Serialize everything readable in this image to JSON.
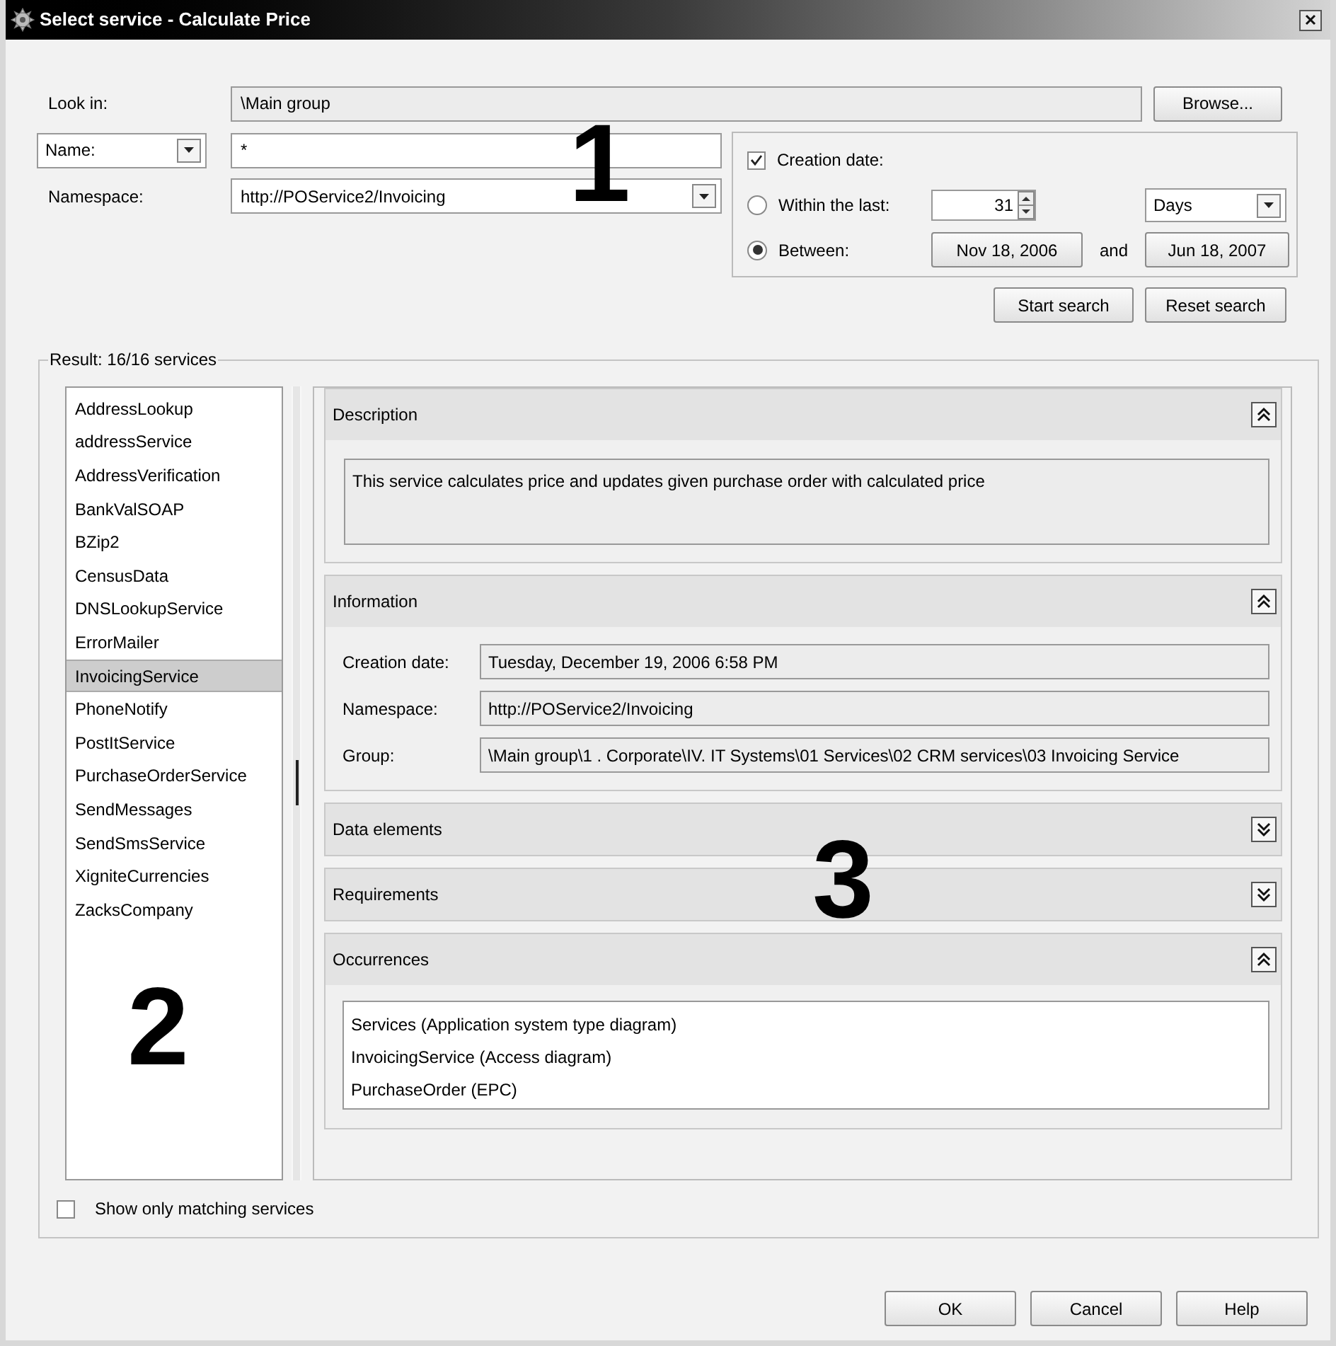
{
  "window": {
    "title": "Select service - Calculate Price"
  },
  "look_in": {
    "label": "Look in:",
    "value": "\\Main group",
    "browse_button": "Browse..."
  },
  "name_filter": {
    "field": "Name:",
    "value": "*"
  },
  "namespace": {
    "label": "Namespace:",
    "value": "http://POService2/Invoicing"
  },
  "creation_date": {
    "label": "Creation date:",
    "checked": true,
    "within_last": {
      "label": "Within the last:",
      "selected": false,
      "value": "31",
      "unit": "Days"
    },
    "between": {
      "label": "Between:",
      "selected": true,
      "from": "Nov 18, 2006",
      "joiner": "and",
      "to": "Jun 18, 2007"
    }
  },
  "search_buttons": [
    "Start search",
    "Reset search"
  ],
  "result": {
    "legend": "Result: 16/16 services",
    "services": [
      {
        "label": "AddressLookup",
        "selected": false
      },
      {
        "label": "addressService",
        "selected": false
      },
      {
        "label": "AddressVerification",
        "selected": false
      },
      {
        "label": "BankValSOAP",
        "selected": false
      },
      {
        "label": "BZip2",
        "selected": false
      },
      {
        "label": "CensusData",
        "selected": false
      },
      {
        "label": "DNSLookupService",
        "selected": false
      },
      {
        "label": "ErrorMailer",
        "selected": false
      },
      {
        "label": "InvoicingService",
        "selected": true
      },
      {
        "label": "PhoneNotify",
        "selected": false
      },
      {
        "label": "PostItService",
        "selected": false
      },
      {
        "label": "PurchaseOrderService",
        "selected": false
      },
      {
        "label": "SendMessages",
        "selected": false
      },
      {
        "label": "SendSmsService",
        "selected": false
      },
      {
        "label": "XigniteCurrencies",
        "selected": false
      },
      {
        "label": "ZacksCompany",
        "selected": false
      }
    ],
    "sections": [
      {
        "kind": "text",
        "title": "Description",
        "expanded": true,
        "text": "This service calculates price and updates given purchase order with calculated price"
      },
      {
        "kind": "fields",
        "title": "Information",
        "expanded": true,
        "fields": [
          {
            "label": "Creation date:",
            "value": "Tuesday, December 19, 2006 6:58 PM"
          },
          {
            "label": "Namespace:",
            "value": "http://POService2/Invoicing"
          },
          {
            "label": "Group:",
            "value": "\\Main group\\1 . Corporate\\IV. IT Systems\\01 Services\\02 CRM services\\03 Invoicing Service"
          }
        ]
      },
      {
        "title": "Data elements",
        "expanded": false
      },
      {
        "title": "Requirements",
        "expanded": false
      },
      {
        "kind": "list",
        "title": "Occurrences",
        "expanded": true,
        "items": [
          "Services (Application system type diagram)",
          "InvoicingService (Access diagram)",
          "PurchaseOrder (EPC)"
        ]
      }
    ],
    "show_only_matching": {
      "label": "Show only matching services",
      "checked": false
    }
  },
  "buttons": [
    "OK",
    "Cancel",
    "Help"
  ],
  "callouts": [
    "1",
    "2",
    "3"
  ]
}
